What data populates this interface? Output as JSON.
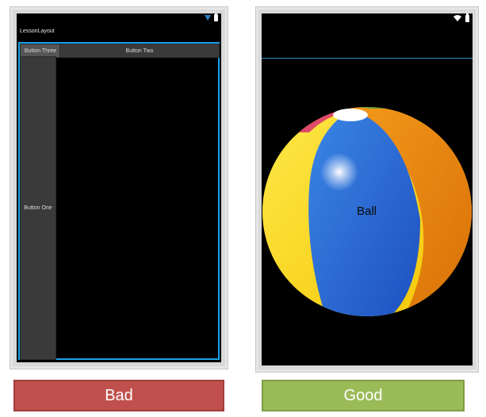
{
  "bad": {
    "app_title": "LessonLayout",
    "button_one": "Button One",
    "button_two": "Button Two",
    "button_three": "Button Three",
    "caption": "Bad",
    "caption_color": "#c0504d"
  },
  "good": {
    "ball_label": "Ball",
    "caption": "Good",
    "caption_color": "#9bbb59"
  },
  "colors": {
    "highlight_border": "#1aa0e6",
    "screen_background": "#000000"
  }
}
